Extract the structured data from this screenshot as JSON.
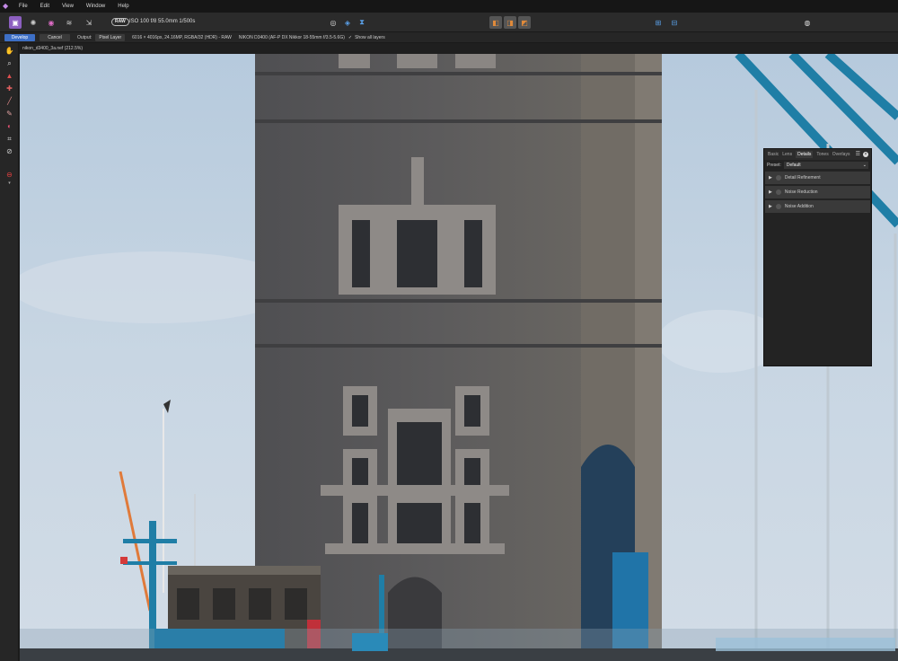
{
  "menubar": {
    "items": [
      "File",
      "Edit",
      "View",
      "Window",
      "Help"
    ]
  },
  "toolbar": {
    "raw_badge": "RAW",
    "exif": "ISO 100  f/8 55.0mm  1/500s"
  },
  "contextbar": {
    "develop": "Develop",
    "cancel": "Cancel",
    "output_label": "Output:",
    "output_value": "Pixel Layer",
    "image_info": "6016 × 4016px, 24.16MP, RGBA/32 (HDR) - RAW",
    "camera_info": "NIKON D3400 (AF-P DX Nikkor 18-55mm f/3.5-5.6G)",
    "show_all_layers": "Show all layers"
  },
  "document": {
    "tab": "nikon_d3400_3a.nef (212.5%)"
  },
  "panel": {
    "tabs": [
      "Basic",
      "Lens",
      "Details",
      "Tones",
      "Overlays"
    ],
    "active_tab": "Details",
    "preset_label": "Preset:",
    "preset_value": "Default",
    "sections": [
      "Detail Refinement",
      "Noise Reduction",
      "Noise Addition"
    ]
  },
  "colors": {
    "accent": "#3d6fc6",
    "sky": "#c4d3e2",
    "stone": "#5b5a5a",
    "bridge_blue": "#1f7ea6"
  }
}
